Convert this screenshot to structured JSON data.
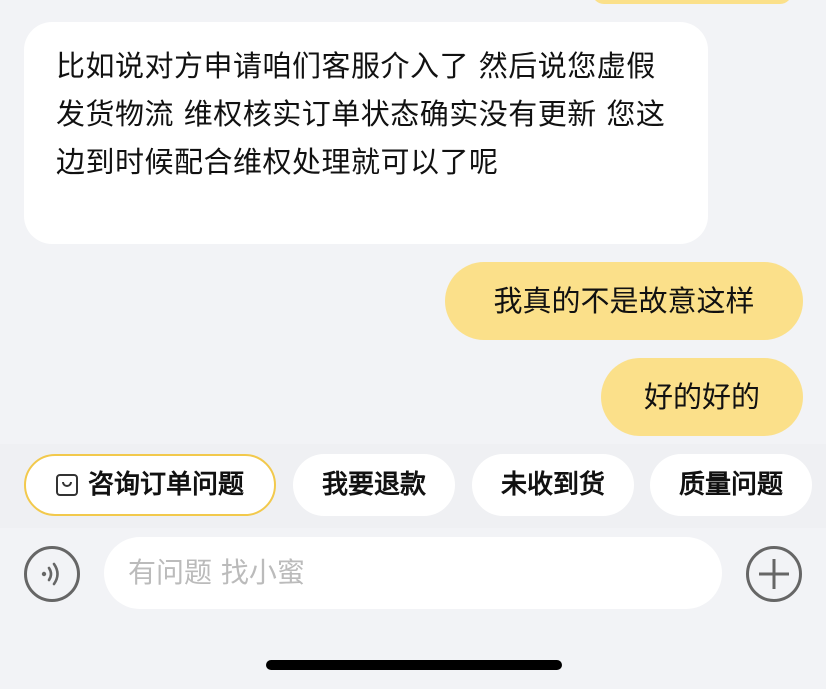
{
  "messages": [
    {
      "from": "agent",
      "text": "比如说对方申请咱们客服介入了 然后说您虚假发货物流 维权核实订单状态确实没有更新  您这边到时候配合维权处理就可以了呢"
    },
    {
      "from": "user",
      "text": "我真的不是故意这样"
    },
    {
      "from": "user",
      "text": "好的好的"
    }
  ],
  "quick_replies": [
    {
      "label": "咨询订单问题",
      "icon": "order-icon"
    },
    {
      "label": "我要退款"
    },
    {
      "label": "未收到货"
    },
    {
      "label": "质量问题"
    }
  ],
  "input": {
    "placeholder": "有问题 找小蜜"
  },
  "colors": {
    "user_bubble": "#fbe08a",
    "agent_bubble": "#ffffff",
    "background": "#f2f3f6",
    "accent_border": "#f2c94c"
  }
}
